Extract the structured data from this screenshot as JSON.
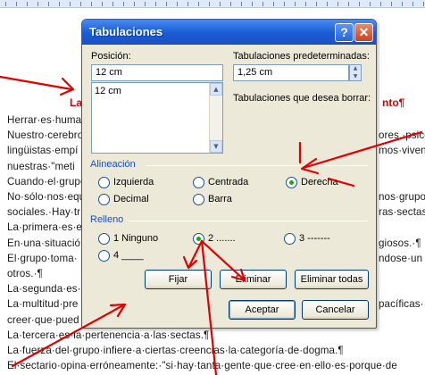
{
  "document": {
    "heading_left": "La",
    "heading_right": "nto¶",
    "lines": [
      {
        "left": "Herrar·es·humano",
        "right": ""
      },
      {
        "left": "Nuestro·cerebro",
        "right": "ores,·psicológicos,"
      },
      {
        "left": "lingüistas·empí",
        "right": "mos·vivencias·de"
      },
      {
        "left": "nuestras·\"meti",
        "right": ""
      },
      {
        "left": "Cuando·el·grupo",
        "right": ""
      },
      {
        "left": "No·sólo·nos·equ",
        "right": "nos·grupos·"
      },
      {
        "left": "sociales.·Hay·tr",
        "right": "ras·sectas.¶"
      },
      {
        "left": "La·primera·es·e",
        "right": ""
      },
      {
        "left": "En·una·situació",
        "right": "giosos.·¶"
      },
      {
        "left": "El·grupo·toma·",
        "right": "ndose·un"
      },
      {
        "left": "otros.·¶",
        "right": ""
      },
      {
        "left": "La·segunda·es·",
        "right": ""
      },
      {
        "left": "La·multitud·pre",
        "right": "pacíficas·"
      },
      {
        "left": "creer·que·pued",
        "right": ""
      },
      {
        "left": "La·tercera·es·la·pertenencia·a·las·sectas.¶",
        "right": ""
      },
      {
        "left": "La·fuerza·del·grupo·infiere·a·ciertas·creencias·la·categoría·de·dogma.¶",
        "right": ""
      },
      {
        "left": "El·sectario·opina·erróneamente:·\"si·hay·tanta·gente·que·cree·en·ello·es·porque·de",
        "right": ""
      }
    ]
  },
  "dialog": {
    "title": "Tabulaciones",
    "help_glyph": "?",
    "close_glyph": "✕",
    "position_label": "Posición:",
    "position_value": "12 cm",
    "tab_list": [
      "12 cm"
    ],
    "default_tabs_label": "Tabulaciones predeterminadas:",
    "default_tabs_value": "1,25 cm",
    "tabs_to_clear_label": "Tabulaciones que desea borrar:",
    "alignment": {
      "label": "Alineación",
      "options": [
        {
          "label": "Izquierda",
          "selected": false
        },
        {
          "label": "Centrada",
          "selected": false
        },
        {
          "label": "Derecha",
          "selected": true
        },
        {
          "label": "Decimal",
          "selected": false
        },
        {
          "label": "Barra",
          "selected": false
        }
      ]
    },
    "leader": {
      "label": "Relleno",
      "options": [
        {
          "label": "1 Ninguno",
          "selected": false
        },
        {
          "label": "2 .......",
          "selected": true
        },
        {
          "label": "3 -------",
          "selected": false
        },
        {
          "label": "4 ____",
          "selected": false
        }
      ]
    },
    "buttons": {
      "set": "Fijar",
      "clear": "Eliminar",
      "clear_all": "Eliminar todas",
      "ok": "Aceptar",
      "cancel": "Cancelar"
    }
  },
  "colors": {
    "annotation_red": "#e00000",
    "title_blue": "#1b5bd6",
    "dialog_bg": "#ece9d8",
    "group_label_blue": "#1a4fc0"
  }
}
